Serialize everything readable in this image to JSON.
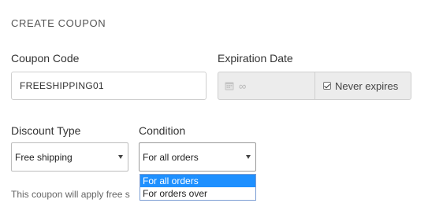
{
  "section_title": "CREATE COUPON",
  "coupon_code": {
    "label": "Coupon Code",
    "value": "FREESHIPPING01"
  },
  "expiration": {
    "label": "Expiration Date",
    "date_value": "∞",
    "never_expires_label": "Never expires",
    "never_expires_checked": true
  },
  "discount_type": {
    "label": "Discount Type",
    "selected": "Free shipping"
  },
  "condition": {
    "label": "Condition",
    "selected": "For all orders",
    "options": [
      "For all orders",
      "For orders over"
    ]
  },
  "note": "This coupon will apply free s",
  "colors": {
    "selected_option_bg": "#1e90ff",
    "disabled_bg": "#ececec"
  },
  "icons": {
    "calendar": "calendar-icon",
    "checkbox": "checkbox-checked-icon",
    "select_arrow": "chevron-down-icon"
  }
}
